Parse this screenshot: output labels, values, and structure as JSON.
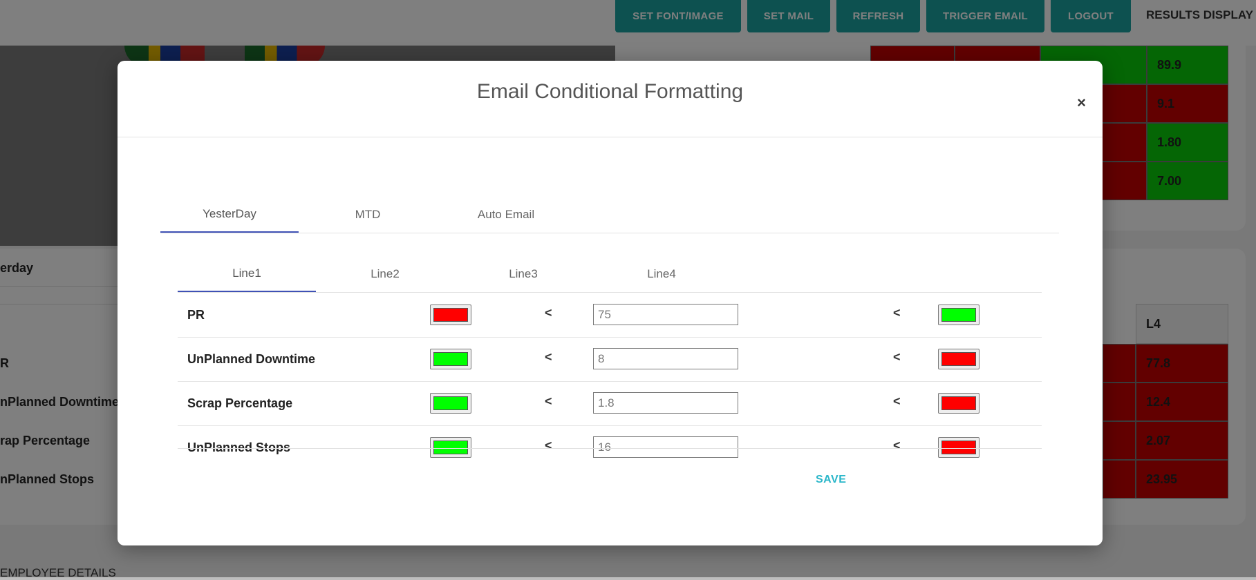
{
  "topbar": {
    "buttons": [
      "SET FONT/IMAGE",
      "SET MAIL",
      "REFRESH",
      "TRIGGER EMAIL",
      "LOGOUT"
    ],
    "title": "RESULTS DISPLAY"
  },
  "background": {
    "summary_values": [
      "89.9",
      "9.1",
      "1.80",
      "7.00"
    ],
    "section_label": "erday",
    "lower_header": "L4",
    "lower_labels": [
      "R",
      "nPlanned Downtime",
      "rap Percentage",
      "nPlanned Stops"
    ],
    "lower_values": [
      "77.8",
      "12.4",
      "2.07",
      "23.95"
    ],
    "employee_label": "EMPLOYEE DETAILS"
  },
  "modal": {
    "title": "Email Conditional Formatting",
    "close_label": "×",
    "period_tabs": [
      {
        "label": "YesterDay",
        "active": true
      },
      {
        "label": "MTD",
        "active": false
      },
      {
        "label": "Auto Email",
        "active": false
      }
    ],
    "line_tabs": [
      {
        "label": "Line1",
        "active": true
      },
      {
        "label": "Line2",
        "active": false
      },
      {
        "label": "Line3",
        "active": false
      },
      {
        "label": "Line4",
        "active": false
      }
    ],
    "operator": "<",
    "rules": [
      {
        "label": "PR",
        "left_color": "#ff0000",
        "value": "75",
        "right_color": "#00ff00"
      },
      {
        "label": "UnPlanned Downtime",
        "left_color": "#00ff00",
        "value": "8",
        "right_color": "#ff0000"
      },
      {
        "label": "Scrap Percentage",
        "left_color": "#00ff00",
        "value": "1.8",
        "right_color": "#ff0000"
      },
      {
        "label": "UnPlanned Stops",
        "left_color": "#00ff00",
        "value": "16",
        "right_color": "#ff0000"
      }
    ],
    "save_label": "SAVE"
  },
  "colors": {
    "accent_teal": "#1aa3a0",
    "tab_underline": "#3f51b5",
    "save_text": "#29b6c9",
    "good_green": "#0bcc0b",
    "bad_red": "#c40000"
  }
}
